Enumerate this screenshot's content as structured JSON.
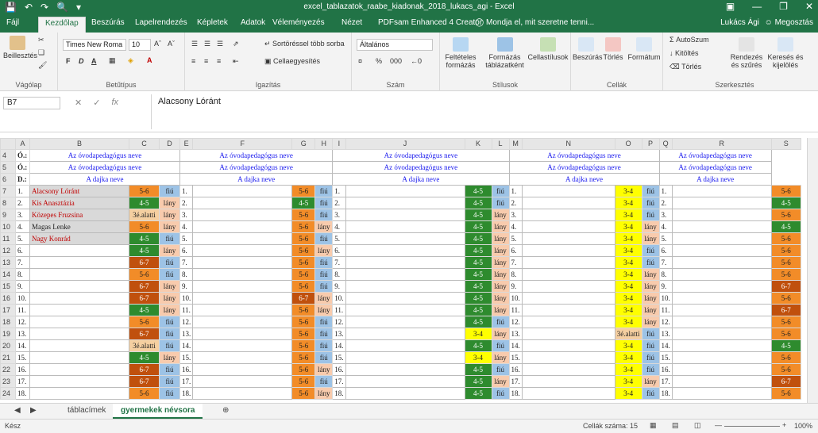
{
  "titlebar": {
    "title": "excel_tablazatok_raabe_kiadonak_2018_lukacs_agi - Excel",
    "qa": [
      "save-icon",
      "undo-icon",
      "redo-icon",
      "print-preview-icon",
      "customize-icon"
    ]
  },
  "tabs": [
    "Fájl",
    "Kezdőlap",
    "Beszúrás",
    "Lapelrendezés",
    "Képletek",
    "Adatok",
    "Véleményezés",
    "Nézet",
    "PDFsam Enhanced 4 Creator",
    "Mondja el, mit szeretne tenni..."
  ],
  "active_tab": "Kezdőlap",
  "user": "Lukács Ági",
  "share": "Megosztás",
  "ribbon": {
    "clipboard": {
      "paste": "Beillesztés",
      "label": "Vágólap"
    },
    "font": {
      "name": "Times New Roma",
      "size": "10",
      "bold": "F",
      "italic": "D",
      "underline": "A",
      "label": "Betűtípus"
    },
    "align": {
      "wrap": "Sortöréssel több sorba",
      "merge": "Cellaegyesítés",
      "label": "Igazítás"
    },
    "number": {
      "format": "Általános",
      "pct": "%",
      "thousands": "000",
      "label": "Szám"
    },
    "styles": {
      "cond": "Feltételes formázás",
      "table": "Formázás táblázatként",
      "cell": "Cellastílusok",
      "label": "Stílusok"
    },
    "cells": {
      "insert": "Beszúrás",
      "delete": "Törlés",
      "format": "Formátum",
      "label": "Cellák"
    },
    "edit": {
      "autosum": "AutoSzum",
      "fill": "Kitöltés",
      "clear": "Törlés",
      "sort": "Rendezés és szűrés",
      "find": "Keresés és kijelölés",
      "label": "Szerkesztés"
    }
  },
  "formula_bar": {
    "namebox": "B7",
    "content": "Alacsony Lóránt"
  },
  "columns": [
    "",
    "A",
    "B",
    "C",
    "D",
    "E",
    "F",
    "G",
    "H",
    "I",
    "J",
    "K",
    "L",
    "M",
    "N",
    "O",
    "P",
    "Q",
    "R",
    "S"
  ],
  "header_rows": [
    {
      "rownum": "4",
      "code": "Ó.:",
      "text": "Az óvodapedagógus neve"
    },
    {
      "rownum": "5",
      "code": "Ó.:",
      "text": "Az óvodapedagógus neve"
    },
    {
      "rownum": "6",
      "code": "D.:",
      "text": "A dajka neve"
    }
  ],
  "names": [
    "Alacsony Lóránt",
    "Kis Anasztázia",
    "Közepes Fruzsina",
    "Magas Lenke",
    "Nagy Konrád"
  ],
  "grid_rows": [
    {
      "r": "7",
      "n": "1.",
      "b1": [
        "5-6",
        "o"
      ],
      "g1": [
        "fiú",
        "fb"
      ],
      "b2": [
        "5-6",
        "o"
      ],
      "g2": [
        "fiú",
        "fb"
      ],
      "b3": [
        "4-5",
        "g"
      ],
      "g3": [
        "fiú",
        "fb"
      ],
      "b4": [
        "3-4",
        "y"
      ],
      "g4": [
        "fiú",
        "fb"
      ],
      "b5": [
        "5-6",
        "o"
      ]
    },
    {
      "r": "8",
      "n": "2.",
      "b1": [
        "4-5",
        "g"
      ],
      "g1": [
        "lány",
        "lp"
      ],
      "b2": [
        "4-5",
        "g"
      ],
      "g2": [
        "fiú",
        "fb"
      ],
      "b3": [
        "4-5",
        "g"
      ],
      "g3": [
        "fiú",
        "fb"
      ],
      "b4": [
        "3-4",
        "y"
      ],
      "g4": [
        "fiú",
        "fb"
      ],
      "b5": [
        "4-5",
        "g"
      ]
    },
    {
      "r": "9",
      "n": "3.",
      "b1": [
        "3é.alatti",
        "tan"
      ],
      "g1": [
        "lány",
        "lp"
      ],
      "b2": [
        "5-6",
        "o"
      ],
      "g2": [
        "fiú",
        "fb"
      ],
      "b3": [
        "4-5",
        "g"
      ],
      "g3": [
        "lány",
        "lp"
      ],
      "b4": [
        "3-4",
        "y"
      ],
      "g4": [
        "fiú",
        "fb"
      ],
      "b5": [
        "5-6",
        "o"
      ]
    },
    {
      "r": "10",
      "n": "4.",
      "b1": [
        "5-6",
        "o"
      ],
      "g1": [
        "lány",
        "lp"
      ],
      "b2": [
        "5-6",
        "o"
      ],
      "g2": [
        "lány",
        "lp"
      ],
      "b3": [
        "4-5",
        "g"
      ],
      "g3": [
        "lány",
        "lp"
      ],
      "b4": [
        "3-4",
        "y"
      ],
      "g4": [
        "lány",
        "lp"
      ],
      "b5": [
        "4-5",
        "g"
      ]
    },
    {
      "r": "11",
      "n": "5.",
      "b1": [
        "4-5",
        "g"
      ],
      "g1": [
        "fiú",
        "fb"
      ],
      "b2": [
        "5-6",
        "o"
      ],
      "g2": [
        "fiú",
        "fb"
      ],
      "b3": [
        "4-5",
        "g"
      ],
      "g3": [
        "lány",
        "lp"
      ],
      "b4": [
        "3-4",
        "y"
      ],
      "g4": [
        "lány",
        "lp"
      ],
      "b5": [
        "5-6",
        "o"
      ]
    },
    {
      "r": "12",
      "n": "6.",
      "b1": [
        "4-5",
        "g"
      ],
      "g1": [
        "lány",
        "lp"
      ],
      "b2": [
        "5-6",
        "o"
      ],
      "g2": [
        "lány",
        "lp"
      ],
      "b3": [
        "4-5",
        "g"
      ],
      "g3": [
        "lány",
        "lp"
      ],
      "b4": [
        "3-4",
        "y"
      ],
      "g4": [
        "fiú",
        "fb"
      ],
      "b5": [
        "5-6",
        "o"
      ]
    },
    {
      "r": "13",
      "n": "7.",
      "b1": [
        "6-7",
        "dk"
      ],
      "g1": [
        "fiú",
        "fb"
      ],
      "b2": [
        "5-6",
        "o"
      ],
      "g2": [
        "fiú",
        "fb"
      ],
      "b3": [
        "4-5",
        "g"
      ],
      "g3": [
        "lány",
        "lp"
      ],
      "b4": [
        "3-4",
        "y"
      ],
      "g4": [
        "fiú",
        "fb"
      ],
      "b5": [
        "5-6",
        "o"
      ]
    },
    {
      "r": "14",
      "n": "8.",
      "b1": [
        "5-6",
        "o"
      ],
      "g1": [
        "fiú",
        "fb"
      ],
      "b2": [
        "5-6",
        "o"
      ],
      "g2": [
        "fiú",
        "fb"
      ],
      "b3": [
        "4-5",
        "g"
      ],
      "g3": [
        "lány",
        "lp"
      ],
      "b4": [
        "3-4",
        "y"
      ],
      "g4": [
        "lány",
        "lp"
      ],
      "b5": [
        "5-6",
        "o"
      ]
    },
    {
      "r": "15",
      "n": "9.",
      "b1": [
        "6-7",
        "dk"
      ],
      "g1": [
        "lány",
        "lp"
      ],
      "b2": [
        "5-6",
        "o"
      ],
      "g2": [
        "fiú",
        "fb"
      ],
      "b3": [
        "4-5",
        "g"
      ],
      "g3": [
        "lány",
        "lp"
      ],
      "b4": [
        "3-4",
        "y"
      ],
      "g4": [
        "lány",
        "lp"
      ],
      "b5": [
        "6-7",
        "dk"
      ]
    },
    {
      "r": "16",
      "n": "10.",
      "b1": [
        "6-7",
        "dk"
      ],
      "g1": [
        "lány",
        "lp"
      ],
      "b2": [
        "6-7",
        "dk"
      ],
      "g2": [
        "lány",
        "lp"
      ],
      "b3": [
        "4-5",
        "g"
      ],
      "g3": [
        "lány",
        "lp"
      ],
      "b4": [
        "3-4",
        "y"
      ],
      "g4": [
        "lány",
        "lp"
      ],
      "b5": [
        "5-6",
        "o"
      ]
    },
    {
      "r": "17",
      "n": "11.",
      "b1": [
        "4-5",
        "g"
      ],
      "g1": [
        "lány",
        "lp"
      ],
      "b2": [
        "5-6",
        "o"
      ],
      "g2": [
        "lány",
        "lp"
      ],
      "b3": [
        "4-5",
        "g"
      ],
      "g3": [
        "lány",
        "lp"
      ],
      "b4": [
        "3-4",
        "y"
      ],
      "g4": [
        "lány",
        "lp"
      ],
      "b5": [
        "6-7",
        "dk"
      ]
    },
    {
      "r": "18",
      "n": "12.",
      "b1": [
        "5-6",
        "o"
      ],
      "g1": [
        "fiú",
        "fb"
      ],
      "b2": [
        "5-6",
        "o"
      ],
      "g2": [
        "fiú",
        "fb"
      ],
      "b3": [
        "4-5",
        "g"
      ],
      "g3": [
        "fiú",
        "fb"
      ],
      "b4": [
        "3-4",
        "y"
      ],
      "g4": [
        "lány",
        "lp"
      ],
      "b5": [
        "5-6",
        "o"
      ]
    },
    {
      "r": "19",
      "n": "13.",
      "b1": [
        "6-7",
        "dk"
      ],
      "g1": [
        "fiú",
        "fb"
      ],
      "b2": [
        "5-6",
        "o"
      ],
      "g2": [
        "fiú",
        "fb"
      ],
      "b3": [
        "3-4",
        "y"
      ],
      "g3": [
        "lány",
        "lp"
      ],
      "b4": [
        "3é.alatti",
        "tan"
      ],
      "g4": [
        "fiú",
        "fb"
      ],
      "b5": [
        "5-6",
        "o"
      ]
    },
    {
      "r": "20",
      "n": "14.",
      "b1": [
        "3é.alatti",
        "tan"
      ],
      "g1": [
        "fiú",
        "fb"
      ],
      "b2": [
        "5-6",
        "o"
      ],
      "g2": [
        "fiú",
        "fb"
      ],
      "b3": [
        "4-5",
        "g"
      ],
      "g3": [
        "fiú",
        "fb"
      ],
      "b4": [
        "3-4",
        "y"
      ],
      "g4": [
        "fiú",
        "fb"
      ],
      "b5": [
        "4-5",
        "g"
      ]
    },
    {
      "r": "21",
      "n": "15.",
      "b1": [
        "4-5",
        "g"
      ],
      "g1": [
        "lány",
        "lp"
      ],
      "b2": [
        "5-6",
        "o"
      ],
      "g2": [
        "fiú",
        "fb"
      ],
      "b3": [
        "3-4",
        "y"
      ],
      "g3": [
        "lány",
        "lp"
      ],
      "b4": [
        "3-4",
        "y"
      ],
      "g4": [
        "fiú",
        "fb"
      ],
      "b5": [
        "5-6",
        "o"
      ]
    },
    {
      "r": "22",
      "n": "16.",
      "b1": [
        "6-7",
        "dk"
      ],
      "g1": [
        "fiú",
        "fb"
      ],
      "b2": [
        "5-6",
        "o"
      ],
      "g2": [
        "lány",
        "lp"
      ],
      "b3": [
        "4-5",
        "g"
      ],
      "g3": [
        "fiú",
        "fb"
      ],
      "b4": [
        "3-4",
        "y"
      ],
      "g4": [
        "fiú",
        "fb"
      ],
      "b5": [
        "5-6",
        "o"
      ]
    },
    {
      "r": "23",
      "n": "17.",
      "b1": [
        "6-7",
        "dk"
      ],
      "g1": [
        "fiú",
        "fb"
      ],
      "b2": [
        "5-6",
        "o"
      ],
      "g2": [
        "fiú",
        "fb"
      ],
      "b3": [
        "4-5",
        "g"
      ],
      "g3": [
        "lány",
        "lp"
      ],
      "b4": [
        "3-4",
        "y"
      ],
      "g4": [
        "lány",
        "lp"
      ],
      "b5": [
        "6-7",
        "dk"
      ]
    },
    {
      "r": "24",
      "n": "18.",
      "b1": [
        "5-6",
        "o"
      ],
      "g1": [
        "fiú",
        "fb"
      ],
      "b2": [
        "5-6",
        "o"
      ],
      "g2": [
        "lány",
        "lp"
      ],
      "b3": [
        "4-5",
        "g"
      ],
      "g3": [
        "fiú",
        "fb"
      ],
      "b4": [
        "3-4",
        "y"
      ],
      "g4": [
        "fiú",
        "fb"
      ],
      "b5": [
        "5-6",
        "o"
      ]
    }
  ],
  "sheet_tabs": [
    "táblacímek",
    "gyermekek névsora"
  ],
  "active_sheet": "gyermekek névsora",
  "status": {
    "ready": "Kész",
    "count": "Cellák száma: 15",
    "zoom": "100%"
  },
  "colors": {
    "accent": "#217346",
    "green": "#2e8b2e",
    "orange": "#f28c28",
    "dark_orange": "#c0500d",
    "yellow": "#ffff00",
    "tan": "#f5cfa0",
    "blue": "#9dc3e6",
    "pink": "#f8cbad",
    "header_blue": "#1a1aee",
    "name_red": "#c00000"
  }
}
